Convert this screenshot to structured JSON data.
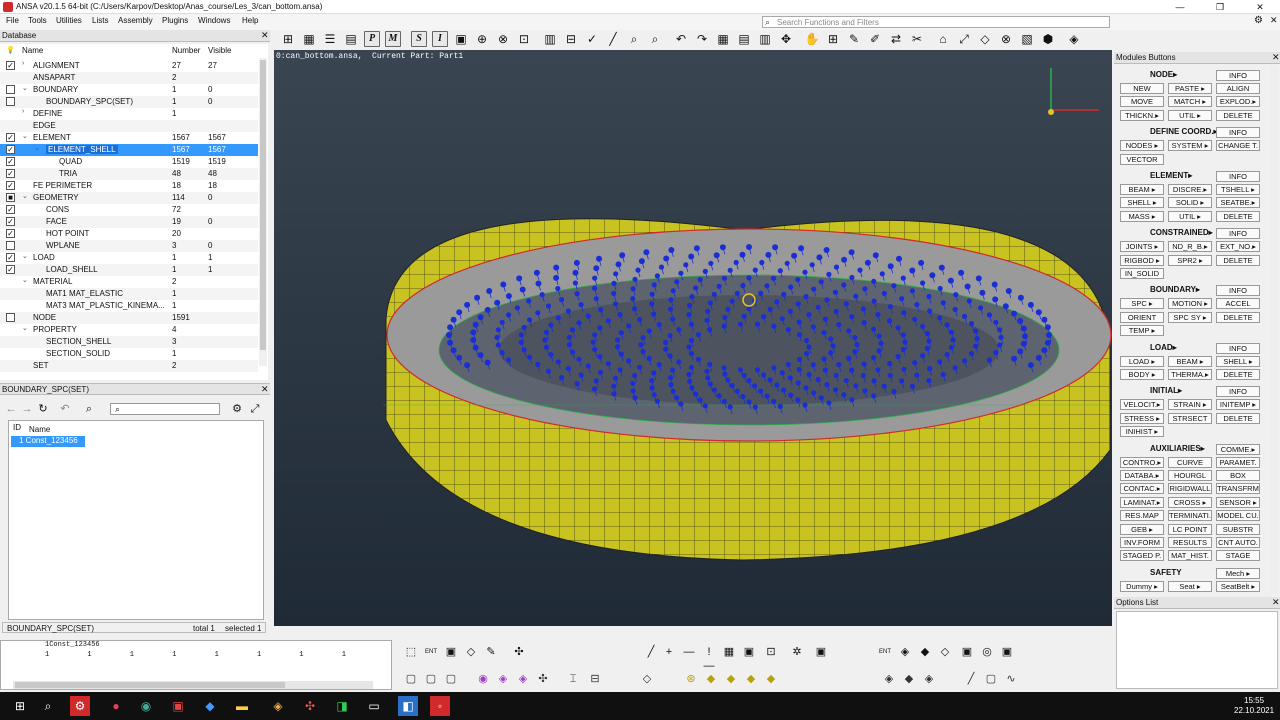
{
  "window": {
    "title": "ANSA v20.1.5 64-bit (C:/Users/Karpov/Desktop/Anas_course/Les_3/can_bottom.ansa)",
    "min": "—",
    "max": "❐",
    "close": "✕",
    "gear": "⚙"
  },
  "menus": [
    "File",
    "Tools",
    "Utilities",
    "Lists",
    "Assembly",
    "Plugins",
    "Windows",
    "Help"
  ],
  "search": {
    "placeholder": "Search Functions and Filters"
  },
  "toolbar": {
    "letters": [
      "P",
      "M",
      "S",
      "I"
    ]
  },
  "database": {
    "title": "Database",
    "col_name": "Name",
    "col_number": "Number",
    "col_visible": "Visible",
    "rows": [
      {
        "name": "ALIGNMENT",
        "number": "27",
        "visible": "27",
        "indent": 1,
        "check": "✓",
        "exp": "›"
      },
      {
        "name": "ANSAPART",
        "number": "2",
        "visible": "",
        "indent": 1,
        "check": "",
        "exp": ""
      },
      {
        "name": "BOUNDARY",
        "number": "1",
        "visible": "0",
        "indent": 1,
        "check": "□",
        "exp": "⌄"
      },
      {
        "name": "BOUNDARY_SPC(SET)",
        "number": "1",
        "visible": "0",
        "indent": 2,
        "check": "□",
        "exp": ""
      },
      {
        "name": "DEFINE",
        "number": "1",
        "visible": "",
        "indent": 1,
        "check": "",
        "exp": "›"
      },
      {
        "name": "EDGE",
        "number": "",
        "visible": "",
        "indent": 1,
        "check": "",
        "exp": ""
      },
      {
        "name": "ELEMENT",
        "number": "1567",
        "visible": "1567",
        "indent": 1,
        "check": "✓",
        "exp": "⌄"
      },
      {
        "name": "ELEMENT_SHELL",
        "number": "1567",
        "visible": "1567",
        "indent": 2,
        "check": "✓",
        "exp": "⌄",
        "selected": true
      },
      {
        "name": "QUAD",
        "number": "1519",
        "visible": "1519",
        "indent": 3,
        "check": "✓",
        "exp": ""
      },
      {
        "name": "TRIA",
        "number": "48",
        "visible": "48",
        "indent": 3,
        "check": "✓",
        "exp": ""
      },
      {
        "name": "FE PERIMETER",
        "number": "18",
        "visible": "18",
        "indent": 1,
        "check": "✓",
        "exp": ""
      },
      {
        "name": "GEOMETRY",
        "number": "114",
        "visible": "0",
        "indent": 1,
        "check": "■",
        "exp": "⌄"
      },
      {
        "name": "CONS",
        "number": "72",
        "visible": "",
        "indent": 2,
        "check": "✓",
        "exp": ""
      },
      {
        "name": "FACE",
        "number": "19",
        "visible": "0",
        "indent": 2,
        "check": "✓",
        "exp": ""
      },
      {
        "name": "HOT POINT",
        "number": "20",
        "visible": "",
        "indent": 2,
        "check": "✓",
        "exp": ""
      },
      {
        "name": "WPLANE",
        "number": "3",
        "visible": "0",
        "indent": 2,
        "check": "□",
        "exp": ""
      },
      {
        "name": "LOAD",
        "number": "1",
        "visible": "1",
        "indent": 1,
        "check": "✓",
        "exp": "⌄"
      },
      {
        "name": "LOAD_SHELL",
        "number": "1",
        "visible": "1",
        "indent": 2,
        "check": "✓",
        "exp": ""
      },
      {
        "name": "MATERIAL",
        "number": "2",
        "visible": "",
        "indent": 1,
        "check": "",
        "exp": "⌄"
      },
      {
        "name": "MAT1 MAT_ELASTIC",
        "number": "1",
        "visible": "",
        "indent": 2,
        "check": "",
        "exp": ""
      },
      {
        "name": "MAT3 MAT_PLASTIC_KINEMA...",
        "number": "1",
        "visible": "",
        "indent": 2,
        "check": "",
        "exp": ""
      },
      {
        "name": "NODE",
        "number": "1591",
        "visible": "",
        "indent": 1,
        "check": "□",
        "exp": ""
      },
      {
        "name": "PROPERTY",
        "number": "4",
        "visible": "",
        "indent": 1,
        "check": "",
        "exp": "⌄"
      },
      {
        "name": "SECTION_SHELL",
        "number": "3",
        "visible": "",
        "indent": 2,
        "check": "",
        "exp": ""
      },
      {
        "name": "SECTION_SOLID",
        "number": "1",
        "visible": "",
        "indent": 2,
        "check": "",
        "exp": ""
      },
      {
        "name": "SET",
        "number": "2",
        "visible": "",
        "indent": 1,
        "check": "",
        "exp": ""
      }
    ]
  },
  "boundary_panel": {
    "title": "BOUNDARY_SPC(SET)",
    "col_id": "ID",
    "col_name": "Name",
    "item": "1  Const_123456",
    "status_name": "BOUNDARY_SPC(SET)",
    "total": "total 1",
    "selected": "selected 1"
  },
  "viewport": {
    "caption": "0:can_bottom.ansa,  Current Part: Part1"
  },
  "modules": {
    "title": "Modules Buttons",
    "groups": [
      {
        "title": "NODE▸",
        "buttons": [
          "INFO",
          "NEW",
          "PASTE ▸",
          "ALIGN",
          "MOVE",
          "MATCH ▸",
          "EXPLOD.▸",
          "THICKN.▸",
          "UTIL ▸",
          "DELETE"
        ]
      },
      {
        "title": "DEFINE COORD.▸",
        "buttons": [
          "INFO",
          "NODES ▸",
          "SYSTEM ▸",
          "CHANGE T.",
          "VECTOR"
        ]
      },
      {
        "title": "ELEMENT▸",
        "buttons": [
          "INFO",
          "BEAM ▸",
          "DISCRE.▸",
          "TSHELL ▸",
          "SHELL ▸",
          "SOLID ▸",
          "SEATBE.▸",
          "MASS ▸",
          "UTIL ▸",
          "DELETE"
        ]
      },
      {
        "title": "CONSTRAINED▸",
        "buttons": [
          "INFO",
          "JOINTS ▸",
          "ND_R_B.▸",
          "EXT_NO.▸",
          "RIGBOD ▸",
          "SPR2 ▸",
          "DELETE",
          "IN_SOLID"
        ]
      },
      {
        "title": "BOUNDARY▸",
        "buttons": [
          "INFO",
          "SPC ▸",
          "MOTION ▸",
          "ACCEL",
          "ORIENT",
          "SPC SY ▸",
          "DELETE",
          "TEMP ▸"
        ]
      },
      {
        "title": "LOAD▸",
        "buttons": [
          "INFO",
          "LOAD ▸",
          "BEAM ▸",
          "SHELL ▸",
          "BODY ▸",
          "THERMA.▸",
          "DELETE"
        ]
      },
      {
        "title": "INITIAL▸",
        "buttons": [
          "INFO",
          "VELOCIT.▸",
          "STRAIN ▸",
          "INITEMP ▸",
          "STRESS ▸",
          "STRSECT",
          "DELETE",
          "INIHIST ▸"
        ]
      },
      {
        "title": "AUXILIARIES▸",
        "buttons": [
          "COMME.▸",
          "CONTRO.▸",
          "CURVE",
          "PARAMET.",
          "DATABA.▸",
          "HOURGL",
          "BOX",
          "CONTAC.▸",
          "RIGIDWALL",
          "TRANSFRM",
          "LAMINAT.▸",
          "CROSS ▸",
          "SENSOR ▸",
          "RES.MAP",
          "TERMINATI.",
          "MODEL CU.",
          "GEB ▸",
          "LC POINT",
          "SUBSTR",
          "INV.FORM",
          "RESULTS",
          "CNT AUTO.",
          "STAGED P.",
          "MAT_HIST.",
          "STAGE"
        ]
      },
      {
        "title": "SAFETY",
        "buttons": [
          "Mech ▸",
          "Dummy ▸",
          "Seat ▸",
          "SeatBelt ▸"
        ]
      }
    ]
  },
  "options": {
    "title": "Options List"
  },
  "log": {
    "line1": "1Const_123456",
    "line2": "1 1 1 1 1 1 1 1"
  },
  "clock": {
    "time": "15:55",
    "date": "22.10.2021"
  },
  "colors": {
    "shell_yellow": "#d6d22a",
    "node_blue": "#1a2ed6",
    "select_blue": "#3399ff",
    "viewport_bg": "#2b3643"
  }
}
